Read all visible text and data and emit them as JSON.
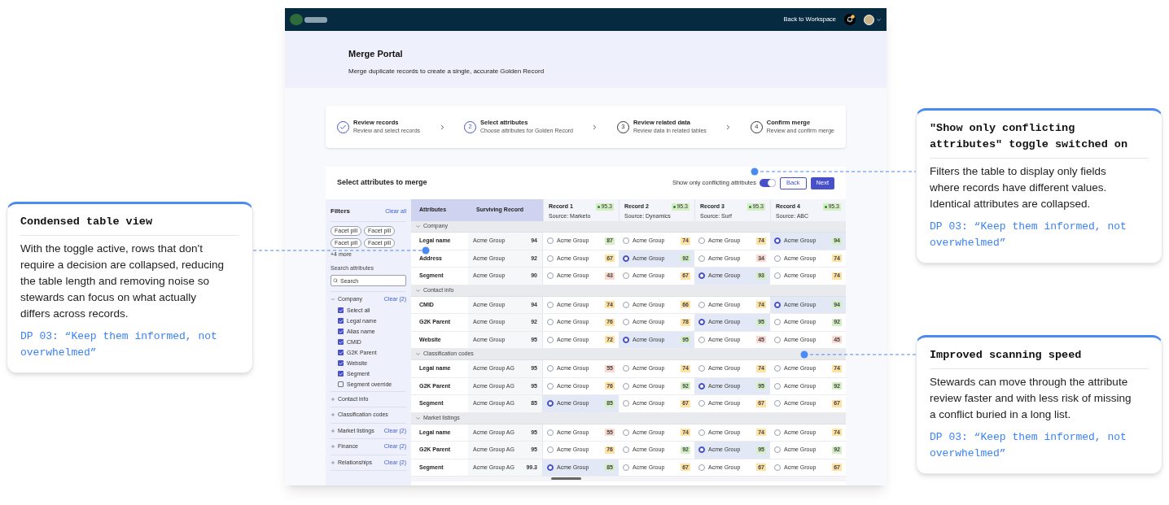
{
  "top_bar": {
    "back_link": "Back to Workspace"
  },
  "header": {
    "title": "Merge Portal",
    "subtitle": "Merge duplicate records to create a single, accurate Golden Record"
  },
  "steps": [
    {
      "title": "Review records",
      "subtitle": "Review and select records",
      "completed": true,
      "selected": false
    },
    {
      "number": "2",
      "title": "Select attributes",
      "subtitle": "Choose attributes for Golden Record",
      "completed": false,
      "selected": true
    },
    {
      "number": "3",
      "title": "Review related data",
      "subtitle": "Review data in related tables",
      "completed": false,
      "selected": false
    },
    {
      "number": "4",
      "title": "Confirm merge",
      "subtitle": "Review and confirm merge",
      "completed": false,
      "selected": false
    }
  ],
  "panel": {
    "title": "Select attributes to merge",
    "toggle": {
      "label": "Show only conflicting attributes",
      "on": true
    },
    "buttons": [
      {
        "label": "Back",
        "kind": "secondary"
      },
      {
        "label": "Next",
        "kind": "primary"
      }
    ]
  },
  "filters": {
    "title": "Filters",
    "clear_all": "Clear all",
    "pills": [
      "Facet pill",
      "Facet pill",
      "Facet pill",
      "Facet pill"
    ],
    "more": "+4 more",
    "search_label": "Search attributes",
    "search_placeholder": "Search",
    "groups": [
      {
        "name": "Company",
        "expanded": true,
        "clear": "Clear (2)",
        "options": [
          {
            "label": "Select all",
            "checked": true
          },
          {
            "label": "Legal name",
            "checked": true
          },
          {
            "label": "Alias name",
            "checked": true
          },
          {
            "label": "CMID",
            "checked": true
          },
          {
            "label": "G2K Parent",
            "checked": true
          },
          {
            "label": "Website",
            "checked": true
          },
          {
            "label": "Segment",
            "checked": true
          },
          {
            "label": "Segment override",
            "checked": false
          }
        ]
      },
      {
        "name": "Contact info",
        "expanded": false
      },
      {
        "name": "Classification codes",
        "expanded": false
      },
      {
        "name": "Market listings",
        "expanded": false,
        "clear": "Clear (2)"
      },
      {
        "name": "Finance",
        "expanded": false,
        "clear": "Clear (2)"
      },
      {
        "name": "Relationships",
        "expanded": false,
        "clear": "Clear (2)"
      }
    ]
  },
  "table": {
    "columns": [
      "Attributes",
      "Surviving Record"
    ],
    "records": [
      {
        "title": "Record 1",
        "source": "Source: Marketo",
        "score": "95.3"
      },
      {
        "title": "Record 2",
        "source": "Source: Dynamics",
        "score": "95.3"
      },
      {
        "title": "Record 3",
        "source": "Source: Surf",
        "score": "95.3"
      },
      {
        "title": "Record 4",
        "source": "Source: ABC",
        "score": "95.3"
      }
    ],
    "groups": [
      {
        "name": "Company",
        "expanded": true,
        "rows": [
          {
            "attribute": "Legal name",
            "surviving": "Acme Group",
            "surviving_score": "94",
            "cells": [
              {
                "value": "Acme Group",
                "score": "87",
                "color": "#d5efc5",
                "selected": false
              },
              {
                "value": "Acme Group",
                "score": "74",
                "color": "#fde2a4",
                "selected": false
              },
              {
                "value": "Acme Group",
                "score": "74",
                "color": "#fde2a4",
                "selected": false
              },
              {
                "value": "Acme Group",
                "score": "94",
                "color": "#d5efc5",
                "selected": true
              }
            ]
          },
          {
            "attribute": "Address",
            "surviving": "Acme Group",
            "surviving_score": "92",
            "cells": [
              {
                "value": "Acme Group",
                "score": "67",
                "color": "#fde2a4",
                "selected": false
              },
              {
                "value": "Acme Group",
                "score": "92",
                "color": "#d5efc5",
                "selected": true
              },
              {
                "value": "Acme Group",
                "score": "34",
                "color": "#fbd8d0",
                "selected": false
              },
              {
                "value": "Acme Group",
                "score": "74",
                "color": "#fde2a4",
                "selected": false
              }
            ]
          },
          {
            "attribute": "Segment",
            "surviving": "Acme Group",
            "surviving_score": "90",
            "cells": [
              {
                "value": "Acme Group",
                "score": "43",
                "color": "#fbd8d0",
                "selected": false
              },
              {
                "value": "Acme Group",
                "score": "67",
                "color": "#fde2a4",
                "selected": false
              },
              {
                "value": "Acme Group",
                "score": "93",
                "color": "#d5efc5",
                "selected": true
              },
              {
                "value": "Acme Group",
                "score": "74",
                "color": "#fde2a4",
                "selected": false
              }
            ]
          }
        ]
      },
      {
        "name": "Contact info",
        "expanded": true,
        "rows": [
          {
            "attribute": "CMID",
            "surviving": "Acme Group",
            "surviving_score": "94",
            "cells": [
              {
                "value": "Acme Group",
                "score": "74",
                "color": "#fde2a4",
                "selected": false
              },
              {
                "value": "Acme Group",
                "score": "66",
                "color": "#fde2a4",
                "selected": false
              },
              {
                "value": "Acme Group",
                "score": "74",
                "color": "#fde2a4",
                "selected": false
              },
              {
                "value": "Acme Group",
                "score": "94",
                "color": "#d5efc5",
                "selected": true
              }
            ]
          },
          {
            "attribute": "G2K Parent",
            "surviving": "Acme Group",
            "surviving_score": "92",
            "cells": [
              {
                "value": "Acme Group",
                "score": "76",
                "color": "#fde2a4",
                "selected": false
              },
              {
                "value": "Acme Group",
                "score": "78",
                "color": "#fde2a4",
                "selected": false
              },
              {
                "value": "Acme Group",
                "score": "95",
                "color": "#d5efc5",
                "selected": true
              },
              {
                "value": "Acme Group",
                "score": "92",
                "color": "#d5efc5",
                "selected": false
              }
            ]
          },
          {
            "attribute": "Website",
            "surviving": "Acme Group",
            "surviving_score": "95",
            "cells": [
              {
                "value": "Acme Group",
                "score": "72",
                "color": "#fde2a4",
                "selected": false
              },
              {
                "value": "Acme Group",
                "score": "95",
                "color": "#d5efc5",
                "selected": true
              },
              {
                "value": "Acme Group",
                "score": "45",
                "color": "#fbd8d0",
                "selected": false
              },
              {
                "value": "Acme Group",
                "score": "45",
                "color": "#fbd8d0",
                "selected": false
              }
            ]
          }
        ]
      },
      {
        "name": "Classification codes",
        "expanded": true,
        "rows": [
          {
            "attribute": "Legal name",
            "surviving": "Acme Group AG",
            "surviving_score": "95",
            "cells": [
              {
                "value": "Acme Group",
                "score": "55",
                "color": "#fbd8d0",
                "selected": false
              },
              {
                "value": "Acme Group",
                "score": "74",
                "color": "#fde2a4",
                "selected": false
              },
              {
                "value": "Acme Group",
                "score": "74",
                "color": "#fde2a4",
                "selected": false
              },
              {
                "value": "Acme Group",
                "score": "74",
                "color": "#fde2a4",
                "selected": false
              }
            ]
          },
          {
            "attribute": "G2K Parent",
            "surviving": "Acme Group AG",
            "surviving_score": "95",
            "cells": [
              {
                "value": "Acme Group",
                "score": "76",
                "color": "#fde2a4",
                "selected": false
              },
              {
                "value": "Acme Group",
                "score": "92",
                "color": "#d5efc5",
                "selected": false
              },
              {
                "value": "Acme Group",
                "score": "95",
                "color": "#d5efc5",
                "selected": true
              },
              {
                "value": "Acme Group",
                "score": "92",
                "color": "#d5efc5",
                "selected": false
              }
            ]
          },
          {
            "attribute": "Segment",
            "surviving": "Acme Group AG",
            "surviving_score": "85",
            "cells": [
              {
                "value": "Acme Group",
                "score": "85",
                "color": "#d5efc5",
                "selected": true
              },
              {
                "value": "Acme Group",
                "score": "67",
                "color": "#fde2a4",
                "selected": false
              },
              {
                "value": "Acme Group",
                "score": "67",
                "color": "#fde2a4",
                "selected": false
              },
              {
                "value": "Acme Group",
                "score": "67",
                "color": "#fde2a4",
                "selected": false
              }
            ]
          }
        ]
      },
      {
        "name": "Market listings",
        "expanded": true,
        "rows": [
          {
            "attribute": "Legal name",
            "surviving": "Acme Group AG",
            "surviving_score": "95",
            "cells": [
              {
                "value": "Acme Group",
                "score": "55",
                "color": "#fbd8d0",
                "selected": false
              },
              {
                "value": "Acme Group",
                "score": "74",
                "color": "#fde2a4",
                "selected": false
              },
              {
                "value": "Acme Group",
                "score": "74",
                "color": "#fde2a4",
                "selected": false
              },
              {
                "value": "Acme Group",
                "score": "74",
                "color": "#fde2a4",
                "selected": false
              }
            ]
          },
          {
            "attribute": "G2K Parent",
            "surviving": "Acme Group AG",
            "surviving_score": "95",
            "cells": [
              {
                "value": "Acme Group",
                "score": "76",
                "color": "#fde2a4",
                "selected": false
              },
              {
                "value": "Acme Group",
                "score": "92",
                "color": "#d5efc5",
                "selected": false
              },
              {
                "value": "Acme Group",
                "score": "95",
                "color": "#d5efc5",
                "selected": true
              },
              {
                "value": "Acme Group",
                "score": "92",
                "color": "#d5efc5",
                "selected": false
              }
            ]
          },
          {
            "attribute": "Segment",
            "surviving": "Acme Group AG",
            "surviving_score": "99.3",
            "cells": [
              {
                "value": "Acme Group",
                "score": "85",
                "color": "#d5efc5",
                "selected": true
              },
              {
                "value": "Acme Group",
                "score": "67",
                "color": "#fde2a4",
                "selected": false
              },
              {
                "value": "Acme Group",
                "score": "67",
                "color": "#fde2a4",
                "selected": false
              },
              {
                "value": "Acme Group",
                "score": "67",
                "color": "#fde2a4",
                "selected": false
              }
            ]
          }
        ]
      }
    ]
  },
  "annotations": {
    "left": [
      {
        "title": "Condensed table view",
        "body": "With the toggle active, rows that don't require a decision are collapsed, reducing the table length and removing noise so stewards can focus on what actually differs across records.",
        "quote": "DP 03: “Keep them informed, not overwhelmed”"
      }
    ],
    "right": [
      {
        "title": "\"Show only conflicting attributes\" toggle switched on",
        "body": "Filters the table to display only fields where records have different values. Identical attributes are collapsed.",
        "quote": "DP 03: “Keep them informed, not overwhelmed”"
      },
      {
        "title": "Improved scanning speed",
        "body": "Stewards can move through the attribute review faster and with less risk of missing a conflict buried in a long list.",
        "quote": "DP 03: “Keep them informed, not overwhelmed”"
      }
    ]
  }
}
